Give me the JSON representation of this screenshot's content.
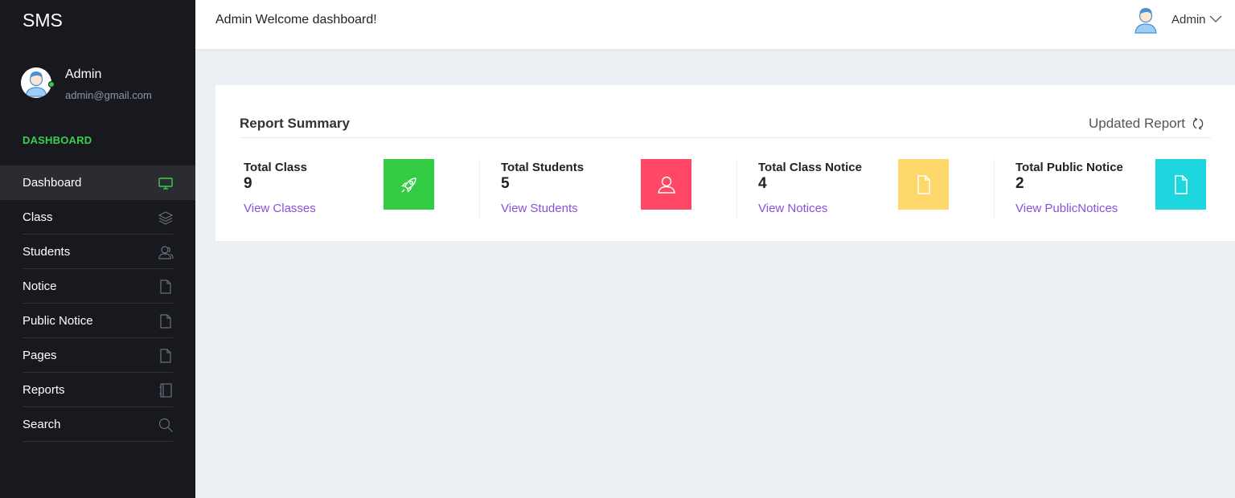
{
  "app": {
    "brand": "SMS"
  },
  "profile": {
    "name": "Admin",
    "email": "admin@gmail.com",
    "status_color": "#2ecc40"
  },
  "sidebar": {
    "section_label": "DASHBOARD",
    "items": [
      {
        "label": "Dashboard",
        "icon": "monitor-icon",
        "active": true
      },
      {
        "label": "Class",
        "icon": "layers-icon"
      },
      {
        "label": "Students",
        "icon": "users-icon"
      },
      {
        "label": "Notice",
        "icon": "file-icon"
      },
      {
        "label": "Public Notice",
        "icon": "file-icon"
      },
      {
        "label": "Pages",
        "icon": "file-icon"
      },
      {
        "label": "Reports",
        "icon": "notebook-icon"
      },
      {
        "label": "Search",
        "icon": "search-icon"
      }
    ]
  },
  "header": {
    "welcome": "Admin Welcome dashboard!",
    "user": "Admin"
  },
  "summary": {
    "title": "Report Summary",
    "updated_label": "Updated Report",
    "stats": [
      {
        "label": "Total Class",
        "value": "9",
        "link": "View Classes",
        "icon": "rocket-icon",
        "color": "#33cc44"
      },
      {
        "label": "Total Students",
        "value": "5",
        "link": "View Students",
        "icon": "user-icon",
        "color": "#ff4766"
      },
      {
        "label": "Total Class Notice",
        "value": "4",
        "link": "View Notices",
        "icon": "file-icon",
        "color": "#ffd86b"
      },
      {
        "label": "Total Public Notice",
        "value": "2",
        "link": "View PublicNotices",
        "icon": "file-icon",
        "color": "#1ed6de"
      }
    ]
  },
  "colors": {
    "sidebar_bg": "#17191f",
    "accent_green": "#37d14a",
    "link_purple": "#8b4fdb",
    "page_bg": "#eceff3"
  }
}
